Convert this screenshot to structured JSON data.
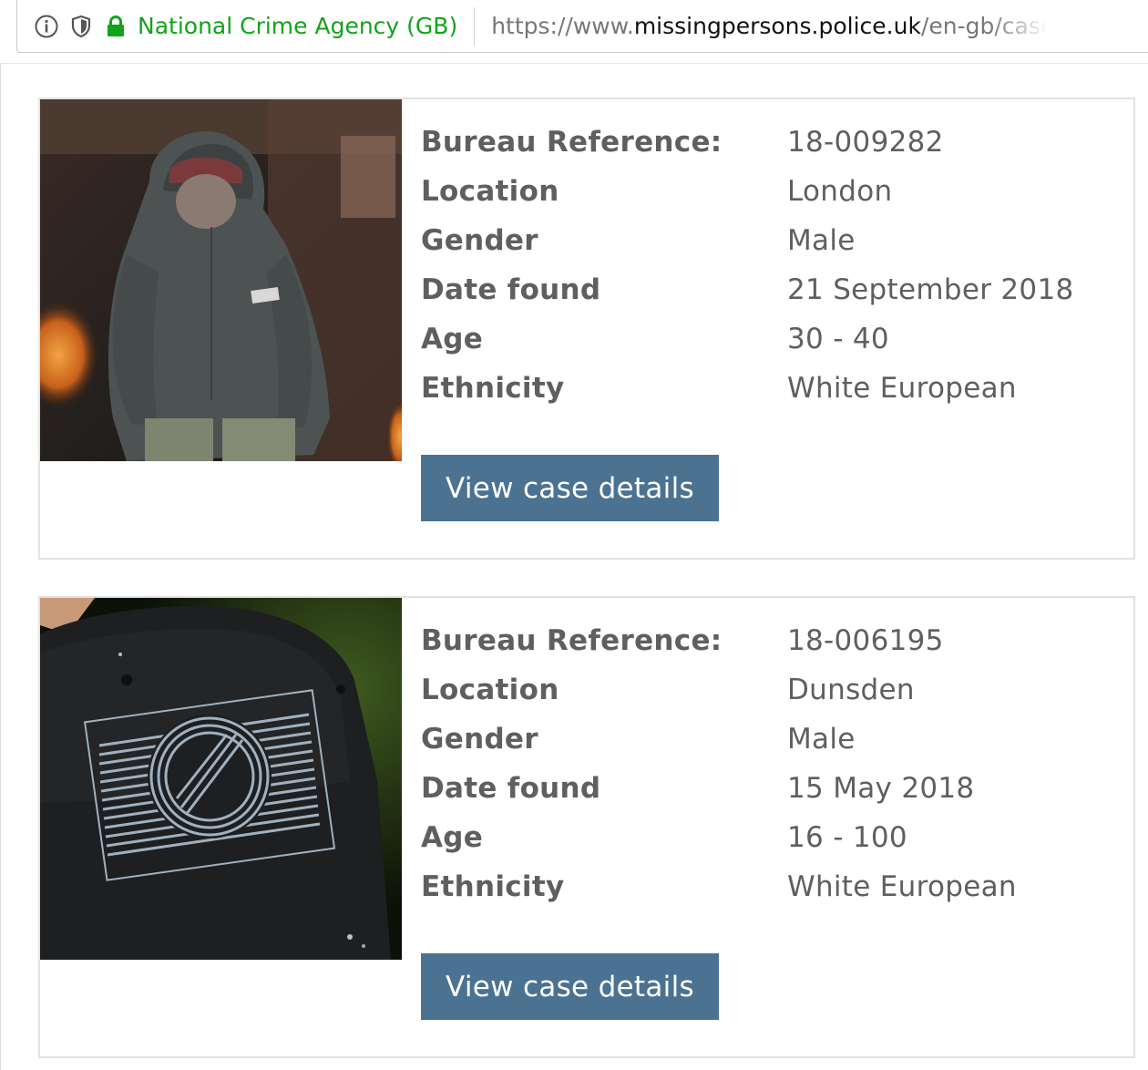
{
  "browser": {
    "identity": "National Crime Agency (GB)",
    "url_prefix": "https://www.",
    "url_domain": "missingpersons.police.uk",
    "url_path": "/en-gb/case-",
    "icons": [
      "info-icon",
      "shield-icon",
      "lock-icon"
    ],
    "identity_color": "#12a31b"
  },
  "cases": [
    {
      "photo": "person-in-grey-hoodie-and-red-cap",
      "fields": [
        {
          "label": "Bureau Reference:",
          "value": "18-009282"
        },
        {
          "label": "Location",
          "value": "London"
        },
        {
          "label": "Gender",
          "value": "Male"
        },
        {
          "label": "Date found",
          "value": "21 September 2018"
        },
        {
          "label": "Age",
          "value": "30 - 40"
        },
        {
          "label": "Ethnicity",
          "value": "White European"
        }
      ],
      "button_label": "View case details"
    },
    {
      "photo": "black-baseball-cap-with-logo",
      "fields": [
        {
          "label": "Bureau Reference:",
          "value": "18-006195"
        },
        {
          "label": "Location",
          "value": "Dunsden"
        },
        {
          "label": "Gender",
          "value": "Male"
        },
        {
          "label": "Date found",
          "value": "15 May 2018"
        },
        {
          "label": "Age",
          "value": "16 - 100"
        },
        {
          "label": "Ethnicity",
          "value": "White European"
        }
      ],
      "button_label": "View case details"
    }
  ],
  "colors": {
    "button": "#4b7291",
    "text": "#5f5f5f",
    "card_border": "#e2e2e2"
  }
}
